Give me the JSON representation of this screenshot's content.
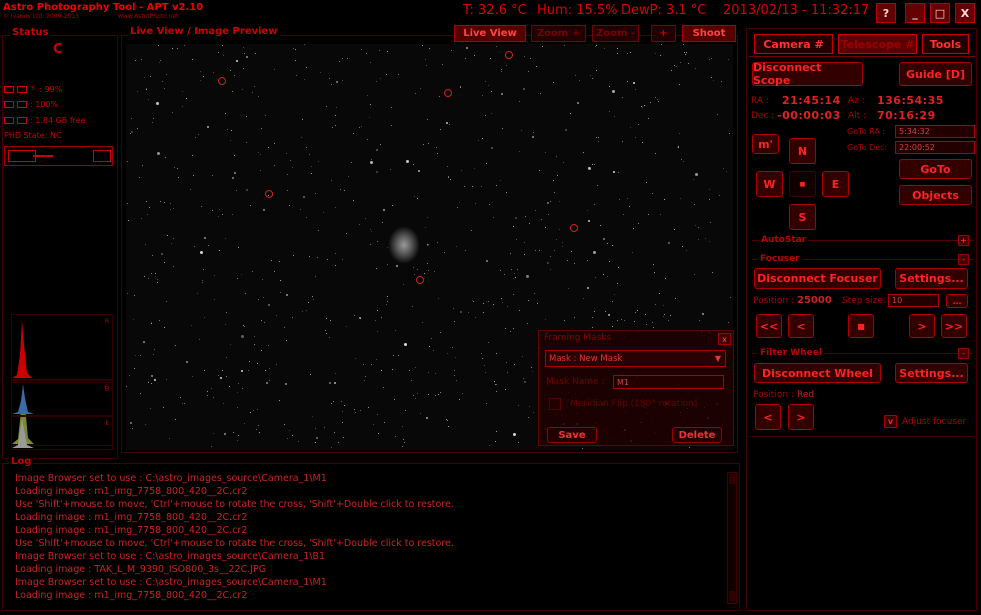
{
  "titlebar": {
    "app_title": "Astro Photography Tool - APT v2.10",
    "copyright": "© Ivanov Ltd. 2009-2013",
    "url": "www.AstroPhoto.net",
    "temp": "T: 32.6 °C",
    "hum": "Hum: 15.5%",
    "dewp": "DewP: 3.1 °C",
    "datetime": "2013/02/13 - 11:32:17",
    "help": "?",
    "minimize": "_",
    "maximize": "□",
    "close": "X"
  },
  "status": {
    "title": "Status",
    "state": "C",
    "battery": ": 99%",
    "link": ": 100%",
    "disk": ": 1.84 GB free",
    "phd": "PHD State: NC"
  },
  "histogram": {
    "labels": [
      "R",
      "G",
      "B",
      "L"
    ]
  },
  "liveview": {
    "title": "Live View / Image Preview",
    "live_view": "Live View",
    "zoom_in": "Zoom +",
    "zoom_out": "Zoom -",
    "crosshair": "+",
    "shoot": "Shoot"
  },
  "framing": {
    "title": "Framing Masks",
    "close": "x",
    "mask_select": "Mask : New Mask",
    "mask_name_label": "Mask Name :",
    "mask_name_value": "M1",
    "meridian_flip": "Meridian Flip (180° rotation)",
    "save": "Save",
    "delete": "Delete"
  },
  "tabs": {
    "camera": "Camera #",
    "telescope": "Telescope #",
    "tools": "Tools"
  },
  "scope": {
    "disconnect": "Disconnect Scope",
    "guide": "Guide [D]",
    "ra_label": "RA :",
    "ra_value": "21:45:14",
    "az_label": "Az :",
    "az_value": "136:54:35",
    "dec_label": "Dec :",
    "dec_value": "-00:00:03",
    "alt_label": "Alt :",
    "alt_value": "70:16:29",
    "goto_ra_label": "GoTo RA :",
    "goto_ra_value": "5:34:32",
    "goto_dec_label": "GoTo Dec:",
    "goto_dec_value": "22:00:52",
    "rate": "m'",
    "north": "N",
    "west": "W",
    "stop": "■",
    "east": "E",
    "south": "S",
    "goto": "GoTo",
    "objects": "Objects"
  },
  "autostar": {
    "title": "AutoStar",
    "toggle": "+"
  },
  "focuser": {
    "title": "Focuser",
    "toggle": "-",
    "disconnect": "Disconnect Focuser",
    "settings": "Settings...",
    "position_label": "Position :",
    "position_value": "25000",
    "step_label": "Step size:",
    "step_value": "10",
    "more": "...",
    "far_in": "<<",
    "in": "<",
    "stop": "■",
    "out": ">",
    "far_out": ">>"
  },
  "filterwheel": {
    "title": "Filter Wheel",
    "toggle": "-",
    "disconnect": "Disconnect Wheel",
    "settings": "Settings...",
    "position_label": "Position :",
    "position_value": "Red",
    "prev": "<",
    "next": ">",
    "adjust_check": "v",
    "adjust_label": "Adjust focuser"
  },
  "log": {
    "title": "Log",
    "lines": [
      "Image Browser set to use : C:\\astro_images_source\\Camera_1\\M1",
      "Loading image : m1_img_7758_800_420__2C.cr2",
      "Use 'Shift'+mouse to move, 'Ctrl'+mouse to rotate the cross, 'Shift'+Double click to restore.",
      "Loading image : m1_img_7758_800_420__2C.cr2",
      "Loading image : m1_img_7758_800_420__2C.cr2",
      "Use 'Shift'+mouse to move, 'Ctrl'+mouse to rotate the cross, 'Shift'+Double click to restore.",
      "Image Browser set to use : C:\\astro_images_source\\Camera_1\\B1",
      "Loading image : TAK_L_M_9390_ISO800_3s__22C.JPG",
      "Image Browser set to use : C:\\astro_images_source\\Camera_1\\M1",
      "Loading image : m1_img_7758_800_420__2C.cr2"
    ]
  }
}
